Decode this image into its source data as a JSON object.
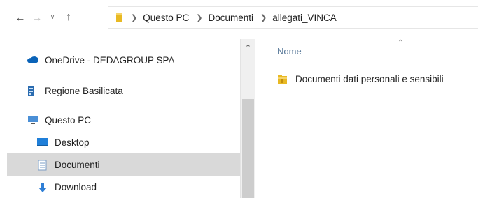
{
  "breadcrumb": {
    "items": [
      "Questo PC",
      "Documenti",
      "allegati_VINCA"
    ]
  },
  "sidebar": {
    "items": [
      {
        "label": "OneDrive - DEDAGROUP SPA",
        "icon": "onedrive-cloud-icon"
      },
      {
        "label": "Regione Basilicata",
        "icon": "building-icon"
      },
      {
        "label": "Questo PC",
        "icon": "computer-icon"
      },
      {
        "label": "Desktop",
        "icon": "desktop-icon"
      },
      {
        "label": "Documenti",
        "icon": "documents-icon",
        "selected": true
      },
      {
        "label": "Download",
        "icon": "download-arrow-icon"
      }
    ]
  },
  "content": {
    "column_header": "Nome",
    "files": [
      {
        "name": "Documenti dati personali e sensibili",
        "icon": "locked-folder-icon"
      }
    ]
  },
  "colors": {
    "folder_yellow": "#e8b923",
    "selected_row": "#d9d9d9",
    "onedrive_blue": "#0a63b8"
  }
}
